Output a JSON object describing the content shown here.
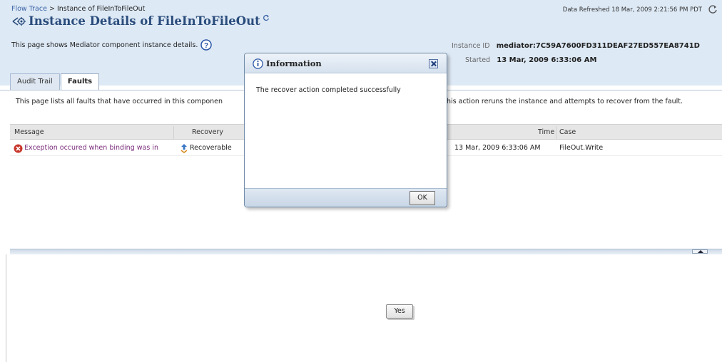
{
  "breadcrumb": {
    "parent": "Flow Trace",
    "separator": ">",
    "current": "Instance of FileInToFileOut"
  },
  "refresh": {
    "text": "Data Refreshed 18 Mar, 2009 2:21:56 PM PDT"
  },
  "header": {
    "title": "Instance Details of FileInToFileOut",
    "description": "This page shows Mediator component instance details."
  },
  "instance": {
    "id_label": "Instance ID",
    "id_value": "mediator:7C59A7600FD311DEAF27ED557EA8741D",
    "started_label": "Started",
    "started_value": "13 Mar, 2009 6:33:06 AM"
  },
  "tabs": [
    {
      "label": "Audit Trail",
      "active": false
    },
    {
      "label": "Faults",
      "active": true
    }
  ],
  "faults": {
    "description_left": "This page lists all faults that have occurred in this componen",
    "description_right": "his action reruns the instance and attempts to recover from the fault.",
    "columns": [
      "Message",
      "Recovery",
      "Time",
      "Case"
    ],
    "rows": [
      {
        "message": "Exception occured when binding was in",
        "recovery": "Recoverable",
        "time": "13 Mar, 2009 6:33:06 AM",
        "case": "FileOut.Write"
      }
    ]
  },
  "bottom": {
    "yes_label": "Yes"
  },
  "dialog": {
    "title": "Information",
    "message": "The recover action completed successfully",
    "ok_label": "OK"
  },
  "colors": {
    "header_bg": "#dde9f5",
    "link": "#3a62a6",
    "title": "#2a4c7c",
    "fault_link": "#7b2d7c",
    "error_red": "#c9372c"
  },
  "icons": {
    "title": "flow-instance-icon",
    "help": "help-icon",
    "refresh": "refresh-icon",
    "error": "error-icon",
    "recovery": "recovery-icon",
    "info": "info-icon",
    "close": "close-icon"
  }
}
